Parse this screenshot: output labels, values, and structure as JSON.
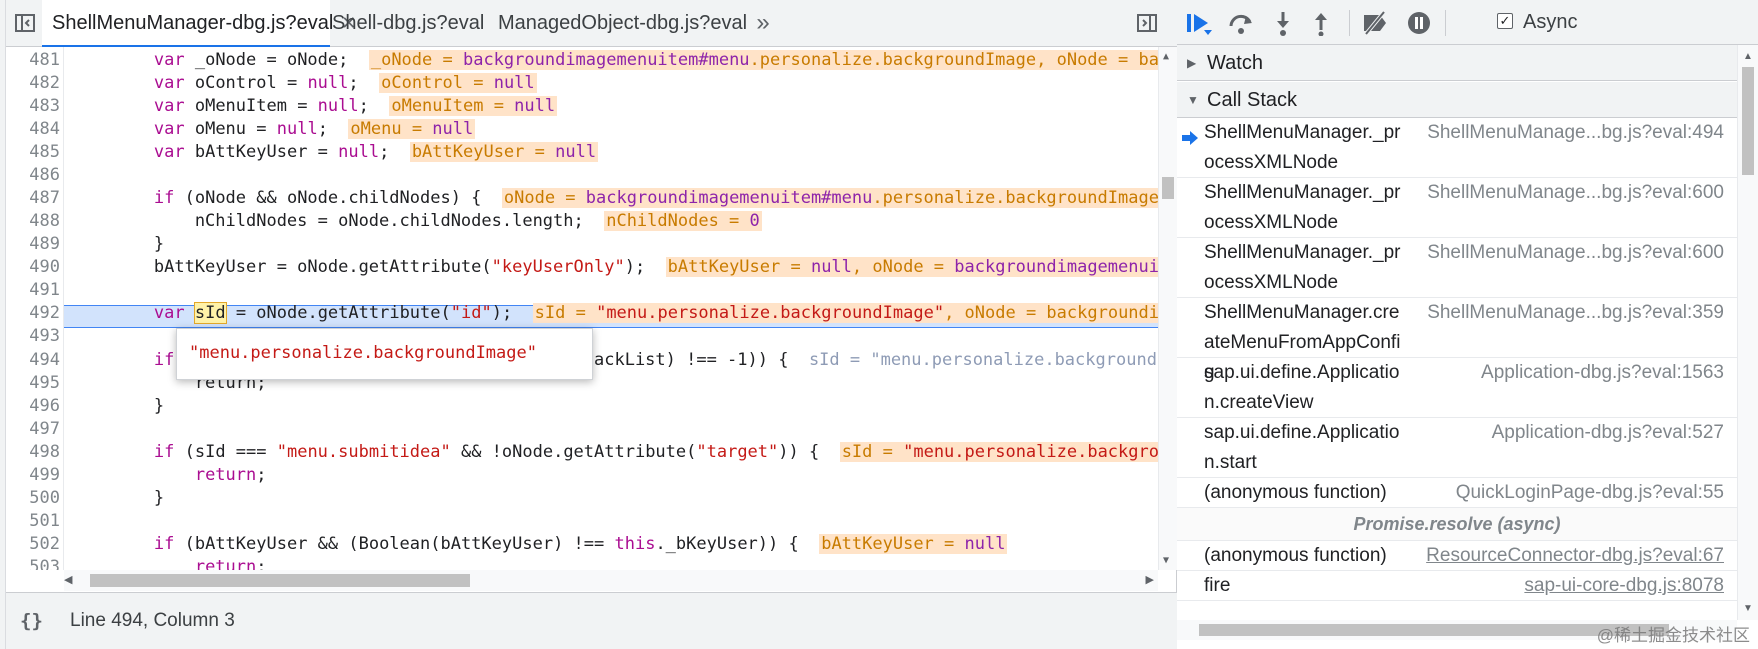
{
  "tabs": [
    {
      "label": "ShellMenuManager-dbg.js?eval",
      "active": true,
      "closable": true
    },
    {
      "label": "Shell-dbg.js?eval",
      "active": false
    },
    {
      "label": "ManagedObject-dbg.js?eval",
      "active": false
    }
  ],
  "more_tabs_glyph": "»",
  "code_lines": [
    {
      "n": "481",
      "code": "        <span class=\"kw\">var</span> _oNode = oNode;  <span class=\"inl\">_oNode = <span class=\"vnm\">backgroundimagemenuitem#menu</span>.personalize.backgroundImage, oNode = backgroundimagemenuitem#menu.per</span>"
    },
    {
      "n": "482",
      "code": "        <span class=\"kw\">var</span> oControl = <span class=\"kw\">null</span>;  <span class=\"inl\">oControl = <span class=\"vnm\">null</span></span>"
    },
    {
      "n": "483",
      "code": "        <span class=\"kw\">var</span> oMenuItem = <span class=\"kw\">null</span>;  <span class=\"inl\">oMenuItem = <span class=\"vnm\">null</span></span>"
    },
    {
      "n": "484",
      "code": "        <span class=\"kw\">var</span> oMenu = <span class=\"kw\">null</span>;  <span class=\"inl\">oMenu = <span class=\"vnm\">null</span></span>"
    },
    {
      "n": "485",
      "code": "        <span class=\"kw\">var</span> bAttKeyUser = <span class=\"kw\">null</span>;  <span class=\"inl\">bAttKeyUser = <span class=\"vnm\">null</span></span>"
    },
    {
      "n": "486",
      "code": ""
    },
    {
      "n": "487",
      "code": "        <span class=\"kw\">if</span> (oNode &amp;&amp; oNode.childNodes) {  <span class=\"inl\">oNode = <span class=\"vnm\">backgroundimagemenuitem#menu</span>.personalize.backgroundImage</span>"
    },
    {
      "n": "488",
      "code": "            nChildNodes = oNode.childNodes.length;  <span class=\"inl\">nChildNodes = <span class=\"vnm\">0</span></span>"
    },
    {
      "n": "489",
      "code": "        }"
    },
    {
      "n": "490",
      "code": "        bAttKeyUser = oNode.getAttribute(<span class=\"str\">\"keyUserOnly\"</span>);  <span class=\"inl\">bAttKeyUser = <span class=\"vnm\">null</span>, oNode = <span class=\"vnm\">backgroundimagemenuitem</span>#menu</span>"
    },
    {
      "n": "491",
      "code": ""
    },
    {
      "n": "492",
      "code": "        <span class=\"kw\">var</span> <span class=\"hl-word\">sId</span> = oNode.getAttribute(<span class=\"str\">\"id\"</span>);  <span class=\"inl\">sId = <span class=\"str2\">\"menu.personalize.backgroundImage\"</span>, oNode = backgroundimage</span>"
    },
    {
      "n": "493",
      "code": ""
    },
    {
      "n": "494",
      "code": "        <span class=\"kw\">if</span> (this._aBlackList.indexOf(sId, this._aBlackList) !== -1)) {  <span style=\"color:#8e9bb5\">sId = \"menu.personalize.backgroundImage\"</span>",
      "exec": true
    },
    {
      "n": "495",
      "code": "            return;"
    },
    {
      "n": "496",
      "code": "        }"
    },
    {
      "n": "497",
      "code": ""
    },
    {
      "n": "498",
      "code": "        <span class=\"kw\">if</span> (sId === <span class=\"str\">\"menu.submitidea\"</span> &amp;&amp; !oNode.getAttribute(<span class=\"str\">\"target\"</span>)) {  <span class=\"inl\">sId = <span class=\"str2\">\"menu.personalize.backgroundImage\"</span></span>"
    },
    {
      "n": "499",
      "code": "            <span class=\"kw\">return</span>;"
    },
    {
      "n": "500",
      "code": "        }"
    },
    {
      "n": "501",
      "code": ""
    },
    {
      "n": "502",
      "code": "        <span class=\"kw\">if</span> (bAttKeyUser &amp;&amp; (Boolean(bAttKeyUser) !== <span class=\"kw\">this</span>._bKeyUser)) {  <span class=\"inl\">bAttKeyUser = <span class=\"vnm\">null</span></span>"
    },
    {
      "n": "503",
      "code": "            <span class=\"kw\">return</span>;"
    },
    {
      "n": "504",
      "code": ""
    }
  ],
  "tooltip_value": "\"menu.personalize.backgroundImage\"",
  "status": {
    "text": "Line 494, Column 3",
    "brace_glyph": "{}"
  },
  "toolbar": {
    "async_label": "Async",
    "async_checked": true
  },
  "sections": {
    "watch": "Watch",
    "call_stack": "Call Stack"
  },
  "call_stack": [
    {
      "name": "ShellMenuManager._processXMLNode",
      "loc": "ShellMenuManage...bg.js?eval:494",
      "current": true
    },
    {
      "name": "ShellMenuManager._processXMLNode",
      "loc": "ShellMenuManage...bg.js?eval:600"
    },
    {
      "name": "ShellMenuManager._processXMLNode",
      "loc": "ShellMenuManage...bg.js?eval:600"
    },
    {
      "name": "ShellMenuManager.createMenuFromAppConfig",
      "loc": "ShellMenuManage...bg.js?eval:359"
    },
    {
      "name": "sap.ui.define.Application.createView",
      "loc": "Application-dbg.js?eval:1563"
    },
    {
      "name": "sap.ui.define.Application.start",
      "loc": "Application-dbg.js?eval:527"
    },
    {
      "name": "(anonymous function)",
      "loc": "QuickLoginPage-dbg.js?eval:55"
    },
    {
      "async": "Promise.resolve (async)"
    },
    {
      "name": "(anonymous function)",
      "loc": "ResourceConnector-dbg.js?eval:67",
      "link": true
    },
    {
      "name": "fire",
      "loc": "sap-ui-core-dbg.js:8078",
      "link": true
    }
  ],
  "watermark": "@稀土掘金技术社区",
  "colors": {
    "accent": "#1a73e8",
    "exec_line": "#d2e3fc",
    "inline_value_bg": "#ffe3c8"
  }
}
